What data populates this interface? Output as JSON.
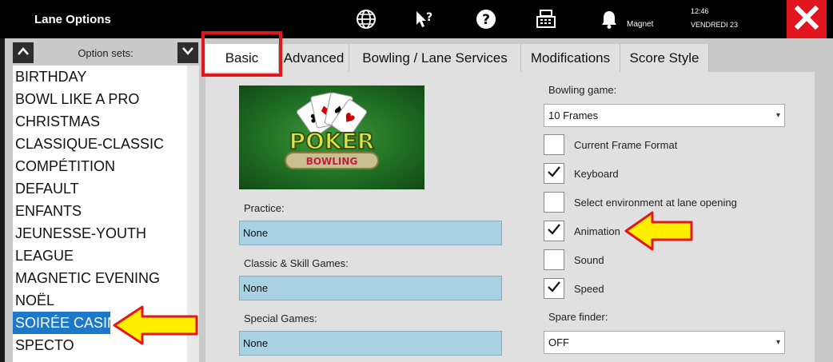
{
  "app": {
    "title": "Lane Options"
  },
  "topbar": {
    "user": "Magnet",
    "time": "12:46",
    "date": "VENDREDI 23"
  },
  "icons": [
    "globe-icon",
    "help-pointer-icon",
    "help-icon",
    "register-icon",
    "bell-icon",
    "close-icon"
  ],
  "option_sets": {
    "label": "Option sets:",
    "items": [
      "BIRTHDAY",
      "BOWL LIKE A PRO",
      "CHRISTMAS",
      "CLASSIQUE-CLASSIC",
      "COMPÉTITION",
      "DEFAULT",
      "ENFANTS",
      "JEUNESSE-YOUTH",
      "LEAGUE",
      "MAGNETIC EVENING",
      "NOËL",
      "SOIRÉE CASINO",
      "SPECTO"
    ],
    "selected": "SOIRÉE CASINO"
  },
  "tabs": [
    "Basic",
    "Advanced",
    "Bowling / Lane Services",
    "Modifications",
    "Score Style"
  ],
  "active_tab": "Basic",
  "basic": {
    "banner_text_1": "POKER",
    "banner_text_2": "BOWLING",
    "practice": {
      "label": "Practice:",
      "value": "None"
    },
    "classic": {
      "label": "Classic & Skill Games:",
      "value": "None"
    },
    "special": {
      "label": "Special Games:",
      "value": "None"
    },
    "bowling_game": {
      "label": "Bowling game:",
      "value": "10 Frames"
    },
    "checkboxes": [
      {
        "label": "Current Frame Format",
        "checked": false
      },
      {
        "label": "Keyboard",
        "checked": true
      },
      {
        "label": "Select environment at lane opening",
        "checked": false
      },
      {
        "label": "Animation",
        "checked": true
      },
      {
        "label": "Sound",
        "checked": false
      },
      {
        "label": "Speed",
        "checked": true
      }
    ],
    "spare_finder": {
      "label": "Spare finder:",
      "value": "OFF"
    }
  },
  "colors": {
    "accent_red": "#e2161f",
    "selection_blue": "#1e78c8",
    "field_blue": "#a8d2e2",
    "annotation_yellow": "#ffee00"
  }
}
